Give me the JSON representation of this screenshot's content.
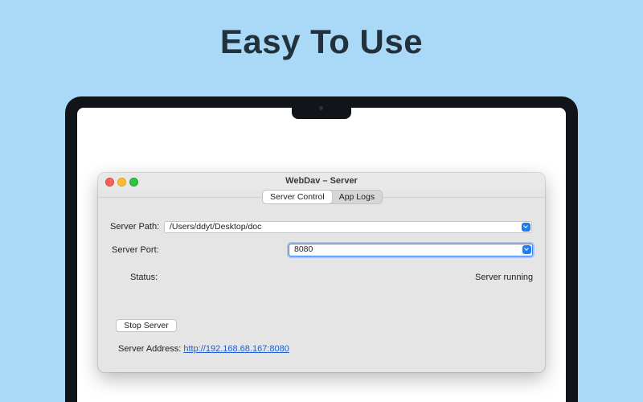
{
  "headline": "Easy To Use",
  "window": {
    "title": "WebDav – Server",
    "tabs": [
      "Server Control",
      "App Logs"
    ],
    "active_tab": "Server Control"
  },
  "form": {
    "path_label": "Server Path:",
    "path_value": "/Users/ddyt/Desktop/doc",
    "port_label": "Server Port:",
    "port_value": "8080",
    "status_label": "Status:",
    "status_value": "Server running",
    "stop_button": "Stop Server",
    "address_label": "Server Address:",
    "address_value": "http://192.168.68.167:8080"
  },
  "colors": {
    "background": "#a9d9f7",
    "accent": "#1f7cf0",
    "link": "#1f5fd0"
  }
}
